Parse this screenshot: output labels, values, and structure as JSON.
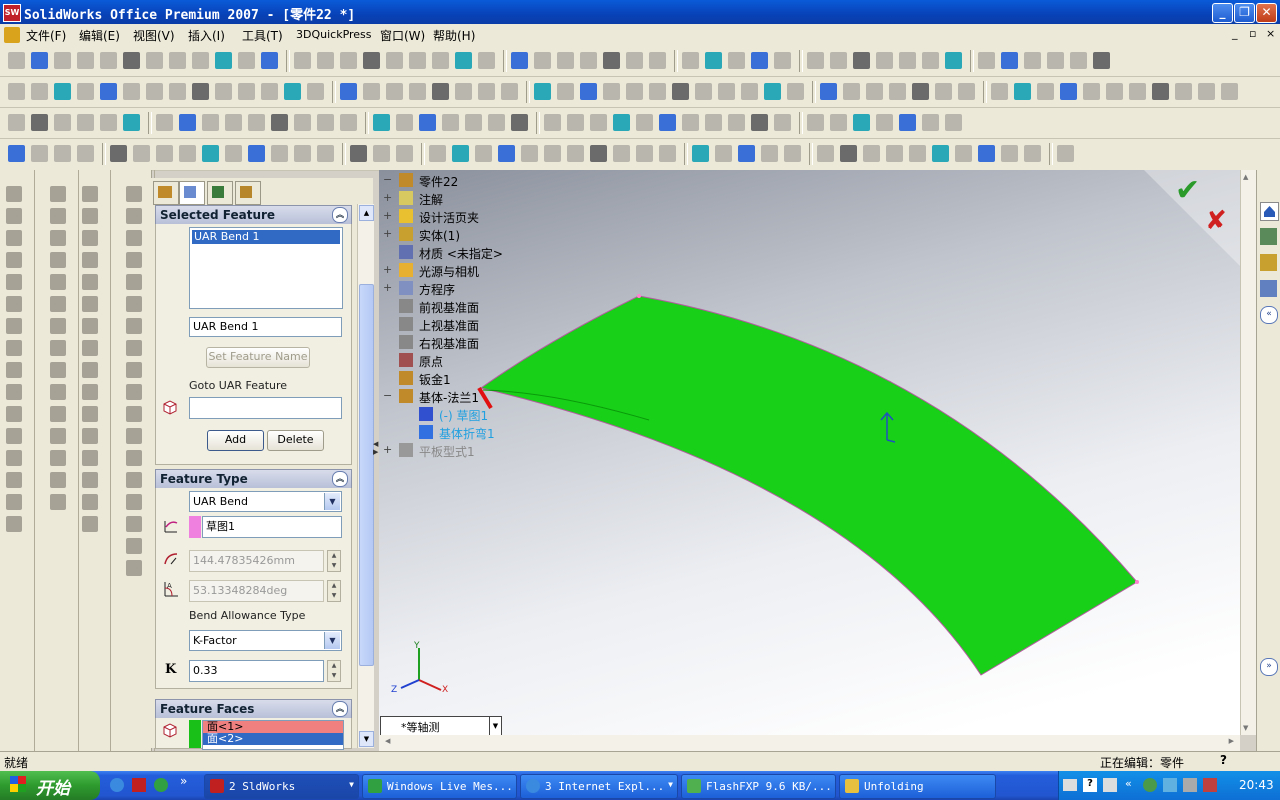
{
  "window": {
    "title": "SolidWorks Office Premium 2007 - [零件22 *]",
    "app_icon": "SW",
    "controls": [
      "minimize-icon",
      "restore-icon",
      "close-icon"
    ]
  },
  "menu": {
    "items": [
      "文件(F)",
      "编辑(E)",
      "视图(V)",
      "插入(I)",
      "工具(T)",
      "3DQuickPress",
      "窗口(W)",
      "帮助(H)"
    ],
    "mdi_controls": [
      "_",
      "▫",
      "×"
    ]
  },
  "property_manager": {
    "selected_feature": {
      "title": "Selected Feature",
      "list": [
        "UAR Bend 1"
      ],
      "name_value": "UAR Bend 1",
      "set_name_button": "Set Feature Name",
      "goto_label": "Goto UAR Feature",
      "goto_value": "",
      "add_button": "Add",
      "delete_button": "Delete"
    },
    "feature_type": {
      "title": "Feature Type",
      "type_value": "UAR Bend",
      "sketch_value": "草图1",
      "radius_value": "144.47835426mm",
      "angle_value": "53.13348284deg",
      "bend_allowance_label": "Bend Allowance Type",
      "bend_allowance_value": "K-Factor",
      "k_label": "K",
      "k_value": "0.33"
    },
    "feature_faces": {
      "title": "Feature Faces",
      "faces": [
        "面<1>",
        "面<2>"
      ]
    }
  },
  "tree": {
    "root": "零件22",
    "items": [
      {
        "label": "注解",
        "expand": "+"
      },
      {
        "label": "设计活页夹",
        "expand": "+"
      },
      {
        "label": "实体(1)",
        "expand": "+"
      },
      {
        "label": "材质 <未指定>",
        "expand": ""
      },
      {
        "label": "光源与相机",
        "expand": "+"
      },
      {
        "label": "方程序",
        "expand": "+"
      },
      {
        "label": "前视基准面",
        "expand": ""
      },
      {
        "label": "上视基准面",
        "expand": ""
      },
      {
        "label": "右视基准面",
        "expand": ""
      },
      {
        "label": "原点",
        "expand": ""
      },
      {
        "label": "钣金1",
        "expand": ""
      },
      {
        "label": "基体-法兰1",
        "expand": "−"
      },
      {
        "label": "(-) 草图1",
        "expand": "",
        "child": true
      },
      {
        "label": "基体折弯1",
        "expand": "",
        "child": true
      },
      {
        "label": "平板型式1",
        "expand": "+",
        "grey": true
      }
    ]
  },
  "viewport": {
    "view_orientation": "*等轴测",
    "part_color": "#18d018",
    "triad_labels": [
      "Y",
      "Z",
      "X"
    ]
  },
  "status": {
    "left": "就绪",
    "right": "正在编辑：零件",
    "help": "?"
  },
  "taskbar": {
    "start": "开始",
    "tasks": [
      {
        "label": "2 SldWorks",
        "icon": "solidworks-icon",
        "active": true
      },
      {
        "label": "Windows Live Mes...",
        "icon": "messenger-icon",
        "active": false
      },
      {
        "label": "3 Internet Expl...",
        "icon": "ie-icon",
        "active": false
      },
      {
        "label": "FlashFXP 9.6 KB/...",
        "icon": "flashfxp-icon",
        "active": false
      },
      {
        "label": "Unfolding",
        "icon": "folder-icon",
        "active": false
      }
    ],
    "clock": "20:43"
  }
}
